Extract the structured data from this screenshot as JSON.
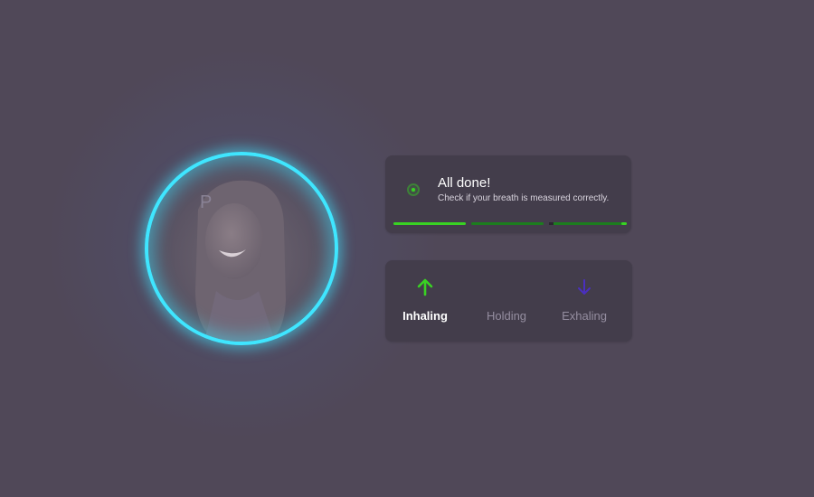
{
  "colors": {
    "background": "#504858",
    "panel": "#433d4b",
    "accent_green": "#39d223",
    "dim_green": "#1c7d1e",
    "ring_cyan": "#3fe6ff",
    "exhale_purple": "#4a2fbf"
  },
  "avatar": {
    "icon": "user-face-photo"
  },
  "status": {
    "icon": "status-dot-icon",
    "title": "All done!",
    "subtitle": "Check if your breath is measured correctly.",
    "progress_segments": [
      1.0,
      0.0,
      1.0
    ]
  },
  "phases": [
    {
      "label": "Inhaling",
      "icon": "arrow-up-icon",
      "active": true
    },
    {
      "label": "Holding",
      "icon": "",
      "active": false
    },
    {
      "label": "Exhaling",
      "icon": "arrow-down-icon",
      "active": false
    }
  ]
}
